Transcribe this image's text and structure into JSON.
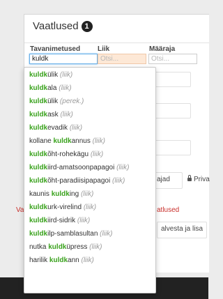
{
  "panel": {
    "title": "Vaatlused",
    "count": "1",
    "columns": {
      "name": "Tavanimetused",
      "type": "Liik",
      "amount": "Määraja"
    },
    "name_value": "kuldk",
    "type_placeholder": "Otsi...",
    "amount_placeholder": "Otsi..."
  },
  "background": {
    "tab_text": "ajad",
    "private_text": "Priva",
    "red_left": "Va",
    "red_right": "atlused",
    "save_text": "alvesta ja lisa"
  },
  "suggestions": [
    {
      "pre": "",
      "match": "kuldk",
      "post": "ülik",
      "type": "(liik)"
    },
    {
      "pre": "",
      "match": "kuldk",
      "post": "ala",
      "type": "(liik)"
    },
    {
      "pre": "",
      "match": "kuldk",
      "post": "ülik",
      "type": "(perek.)"
    },
    {
      "pre": "",
      "match": "kuldk",
      "post": "ask",
      "type": "(liik)"
    },
    {
      "pre": "",
      "match": "kuldk",
      "post": "evadik",
      "type": "(liik)"
    },
    {
      "pre": "kollane ",
      "match": "kuldk",
      "post": "annus",
      "type": "(liik)"
    },
    {
      "pre": "",
      "match": "kuldk",
      "post": "õht-rohekägu",
      "type": "(liik)"
    },
    {
      "pre": "",
      "match": "kuldk",
      "post": "iird-amatsoonpapagoi",
      "type": "(liik)"
    },
    {
      "pre": "",
      "match": "kuldk",
      "post": "õht-paradiisipapagoi",
      "type": "(liik)"
    },
    {
      "pre": "kaunis ",
      "match": "kuldk",
      "post": "ing",
      "type": "(liik)"
    },
    {
      "pre": "",
      "match": "kuldk",
      "post": "urk-virelind",
      "type": "(liik)"
    },
    {
      "pre": "",
      "match": "kuldk",
      "post": "iird-sidrik",
      "type": "(liik)"
    },
    {
      "pre": "",
      "match": "kuldk",
      "post": "ilp-samblasultan",
      "type": "(liik)"
    },
    {
      "pre": "nutka ",
      "match": "kuldk",
      "post": "üpress",
      "type": "(liik)"
    },
    {
      "pre": "harilik ",
      "match": "kuldk",
      "post": "ann",
      "type": "(liik)"
    }
  ]
}
